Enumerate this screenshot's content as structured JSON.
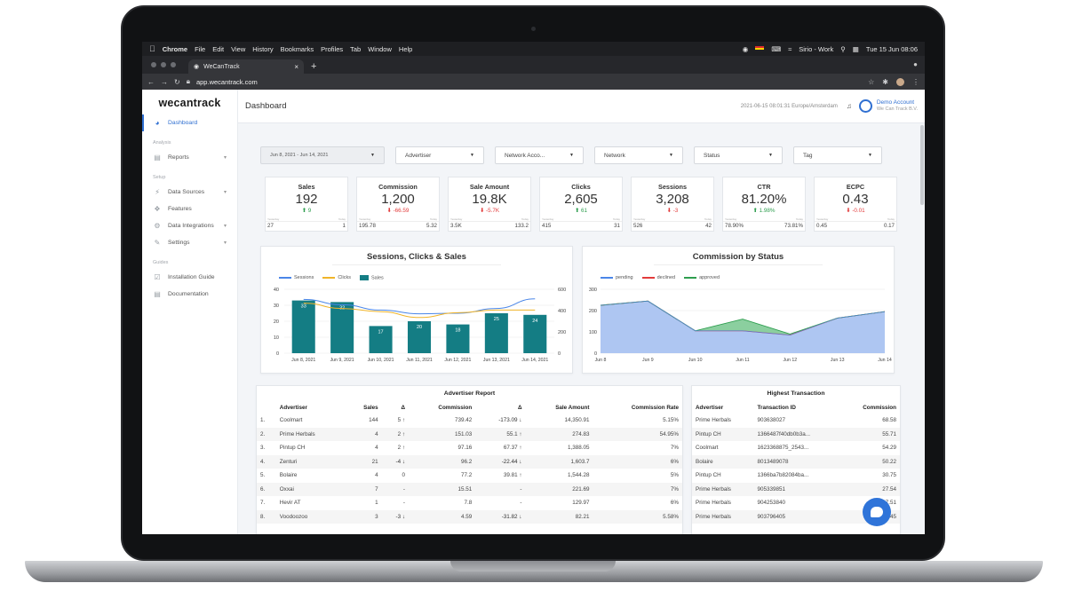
{
  "menubar": {
    "app": "Chrome",
    "items": [
      "File",
      "Edit",
      "View",
      "History",
      "Bookmarks",
      "Profiles",
      "Tab",
      "Window",
      "Help"
    ],
    "profile": "Sirio - Work",
    "clock": "Tue 15 Jun  08:06"
  },
  "browser": {
    "tab_title": "WeCanTrack",
    "url": "app.wecantrack.com"
  },
  "sidebar": {
    "logo": "wecantrack",
    "dashboard": "Dashboard",
    "sections": {
      "analysis": "Analysis",
      "setup": "Setup",
      "guides": "Guides"
    },
    "reports": "Reports",
    "data_sources": "Data Sources",
    "features": "Features",
    "data_integrations": "Data Integrations",
    "settings": "Settings",
    "installation_guide": "Installation Guide",
    "documentation": "Documentation"
  },
  "header": {
    "title": "Dashboard",
    "timestamp": "2021-06-15 08:01:31 Europe/Amsterdam",
    "account_name": "Demo Account",
    "company": "We Can Track B.V."
  },
  "filters": {
    "date_range": "Jun 8, 2021 - Jun 14, 2021",
    "advertiser": "Advertiser",
    "network_account": "Network Acco...",
    "network": "Network",
    "status": "Status",
    "tag": "Tag"
  },
  "kpis": [
    {
      "title": "Sales",
      "value": "192",
      "delta": "9",
      "dir": "up",
      "yesterday": "27",
      "today": "1"
    },
    {
      "title": "Commission",
      "value": "1,200",
      "delta": "-66.59",
      "dir": "down",
      "yesterday": "195.78",
      "today": "5.32"
    },
    {
      "title": "Sale Amount",
      "value": "19.8K",
      "delta": "-5.7K",
      "dir": "down",
      "yesterday": "3.5K",
      "today": "133.2"
    },
    {
      "title": "Clicks",
      "value": "2,605",
      "delta": "61",
      "dir": "up",
      "yesterday": "415",
      "today": "31"
    },
    {
      "title": "Sessions",
      "value": "3,208",
      "delta": "-3",
      "dir": "down",
      "yesterday": "526",
      "today": "42"
    },
    {
      "title": "CTR",
      "value": "81.20%",
      "delta": "1.98%",
      "dir": "up",
      "yesterday": "78.90%",
      "today": "73.81%"
    },
    {
      "title": "ECPC",
      "value": "0.43",
      "delta": "-0.01",
      "dir": "down",
      "yesterday": "0.45",
      "today": "0.17"
    }
  ],
  "kpi_labels": {
    "yesterday": "Yesterday",
    "today": "Today"
  },
  "chart_data": [
    {
      "type": "bar",
      "title": "Sessions, Clicks & Sales",
      "categories": [
        "Jun 8, 2021",
        "Jun 9, 2021",
        "Jun 10, 2021",
        "Jun 11, 2021",
        "Jun 12, 2021",
        "Jun 13, 2021",
        "Jun 14, 2021"
      ],
      "series": [
        {
          "name": "Sessions",
          "kind": "line",
          "axis": "right",
          "color": "#4a86e8",
          "values": [
            505,
            455,
            405,
            370,
            375,
            420,
            510
          ]
        },
        {
          "name": "Clicks",
          "kind": "line",
          "axis": "right",
          "color": "#f0b429",
          "values": [
            470,
            420,
            390,
            335,
            380,
            405,
            405
          ]
        },
        {
          "name": "Sales",
          "kind": "bar",
          "axis": "left",
          "color": "#147d84",
          "values": [
            33,
            32,
            17,
            20,
            18,
            25,
            24
          ]
        }
      ],
      "ylim_left": [
        0,
        40
      ],
      "yticks_left": [
        0,
        10,
        20,
        30,
        40
      ],
      "ylim_right": [
        0,
        600
      ],
      "yticks_right": [
        0,
        200,
        400,
        600
      ],
      "legend": "top"
    },
    {
      "type": "area",
      "title": "Commission by Status",
      "categories": [
        "Jun 8",
        "Jun 9",
        "Jun 10",
        "Jun 11",
        "Jun 12",
        "Jun 13",
        "Jun 14"
      ],
      "series": [
        {
          "name": "pending",
          "color": "#4a86e8",
          "values": [
            225,
            245,
            105,
            105,
            85,
            165,
            195
          ]
        },
        {
          "name": "declined",
          "color": "#e23b3b",
          "values": [
            0,
            0,
            0,
            0,
            0,
            0,
            0
          ]
        },
        {
          "name": "approved",
          "color": "#2e9e4f",
          "values": [
            0,
            0,
            0,
            55,
            5,
            0,
            0
          ]
        }
      ],
      "ylim": [
        0,
        300
      ],
      "yticks": [
        0,
        100,
        200,
        300
      ],
      "legend": "top"
    }
  ],
  "advertiser_report": {
    "title": "Advertiser Report",
    "columns": [
      "",
      "Advertiser",
      "Sales",
      "Δ",
      "Commission",
      "Δ",
      "Sale Amount",
      "Commission Rate"
    ],
    "rows": [
      [
        "1.",
        "Coolmart",
        "144",
        "5 ↑",
        "739.42",
        "-173.09 ↓",
        "14,350.91",
        "5.15%"
      ],
      [
        "2.",
        "Prime Herbals",
        "4",
        "2 ↑",
        "151.03",
        "55.1 ↑",
        "274.83",
        "54.95%"
      ],
      [
        "3.",
        "Pintup CH",
        "4",
        "2 ↑",
        "97.16",
        "67.37 ↑",
        "1,388.05",
        "7%"
      ],
      [
        "4.",
        "Zenturi",
        "21",
        "-4 ↓",
        "96.2",
        "-22.44 ↓",
        "1,603.7",
        "6%"
      ],
      [
        "5.",
        "Bolaire",
        "4",
        "0",
        "77.2",
        "39.81 ↑",
        "1,544.28",
        "5%"
      ],
      [
        "6.",
        "Oxxai",
        "7",
        "-",
        "15.51",
        "-",
        "221.69",
        "7%"
      ],
      [
        "7.",
        "Hevir AT",
        "1",
        "-",
        "7.8",
        "-",
        "129.97",
        "6%"
      ],
      [
        "8.",
        "Voodoozoo",
        "3",
        "-3 ↓",
        "4.59",
        "-31.82 ↓",
        "82.21",
        "5.58%"
      ]
    ]
  },
  "highest_transaction": {
    "title": "Highest Transaction",
    "columns": [
      "Advertiser",
      "Transaction ID",
      "Commission"
    ],
    "rows": [
      [
        "Prime Herbals",
        "903638027",
        "68.58"
      ],
      [
        "Pintup CH",
        "1366487f40db0b3a...",
        "55.71"
      ],
      [
        "Coolmart",
        "1623368875_2543...",
        "54.29"
      ],
      [
        "Bolaire",
        "8013489078",
        "50.22"
      ],
      [
        "Pintup CH",
        "1366ba7b82084ba...",
        "30.75"
      ],
      [
        "Prime Herbals",
        "905339851",
        "27.54"
      ],
      [
        "Prime Herbals",
        "904253840",
        "27.51"
      ],
      [
        "Prime Herbals",
        "903796405",
        "27.45"
      ]
    ]
  }
}
